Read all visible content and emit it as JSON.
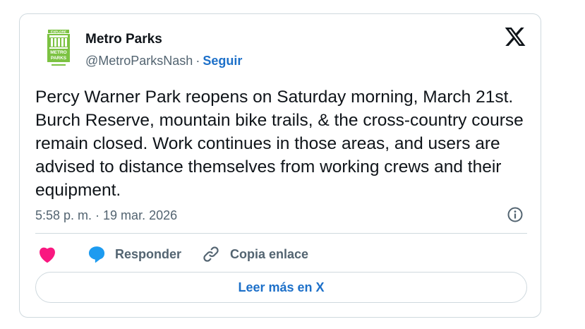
{
  "account": {
    "display_name": "Metro Parks",
    "handle": "@MetroParksNash",
    "separator": "·",
    "follow_label": "Seguir",
    "avatar": {
      "icon": "metro-parks-logo",
      "text_top": "EXPLORE",
      "text_line1": "METRO",
      "text_line2": "PARKS",
      "color": "#7cc242"
    }
  },
  "tweet": {
    "text": "Percy Warner Park reopens on Saturday morning, March 21st.  Burch Reserve, mountain bike trails, & the cross-country course remain closed. Work continues in those areas, and users are advised to distance themselves from working crews and their equipment.",
    "timestamp": "5:58 p. m. · 19 mar. 2026"
  },
  "actions": {
    "like": {
      "icon": "heart-icon",
      "color": "#f91880"
    },
    "reply": {
      "icon": "reply-bubble-icon",
      "label": "Responder",
      "color": "#1d9bf0"
    },
    "copy_link": {
      "icon": "link-icon",
      "label": "Copia enlace"
    }
  },
  "read_more_label": "Leer más en X",
  "colors": {
    "text_primary": "#0f1419",
    "text_secondary": "#536471",
    "link": "#1d70c9",
    "border": "#cfd9de"
  }
}
